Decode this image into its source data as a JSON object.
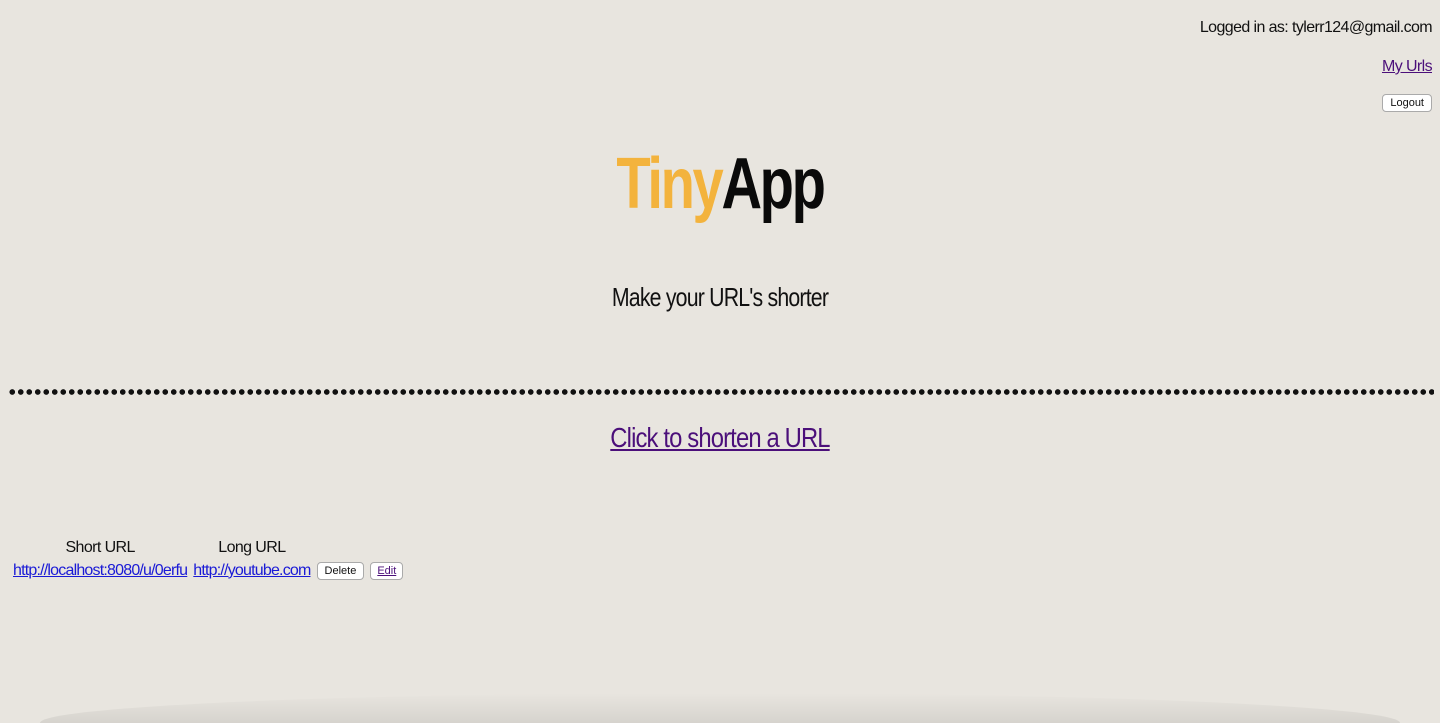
{
  "header": {
    "logged_in_text": "Logged in as: tylerr124@gmail.com",
    "my_urls_label": "My Urls",
    "logout_label": "Logout"
  },
  "logo": {
    "part1": "Tiny",
    "part2": "App",
    "part1_color": "#f3b33d",
    "part2_color": "#0a0a0a"
  },
  "tagline": "Make your URL's shorter",
  "shorten_link_label": "Click to shorten a URL",
  "table": {
    "headers": [
      "Short URL",
      "Long URL"
    ],
    "rows": [
      {
        "short_url": "http://localhost:8080/u/0erfu",
        "long_url": "http://youtube.com",
        "delete_label": "Delete",
        "edit_label": "Edit"
      }
    ]
  },
  "colors": {
    "background": "#e8e5df",
    "visited_link": "#4b0f7a",
    "link": "#1a1ad6"
  }
}
